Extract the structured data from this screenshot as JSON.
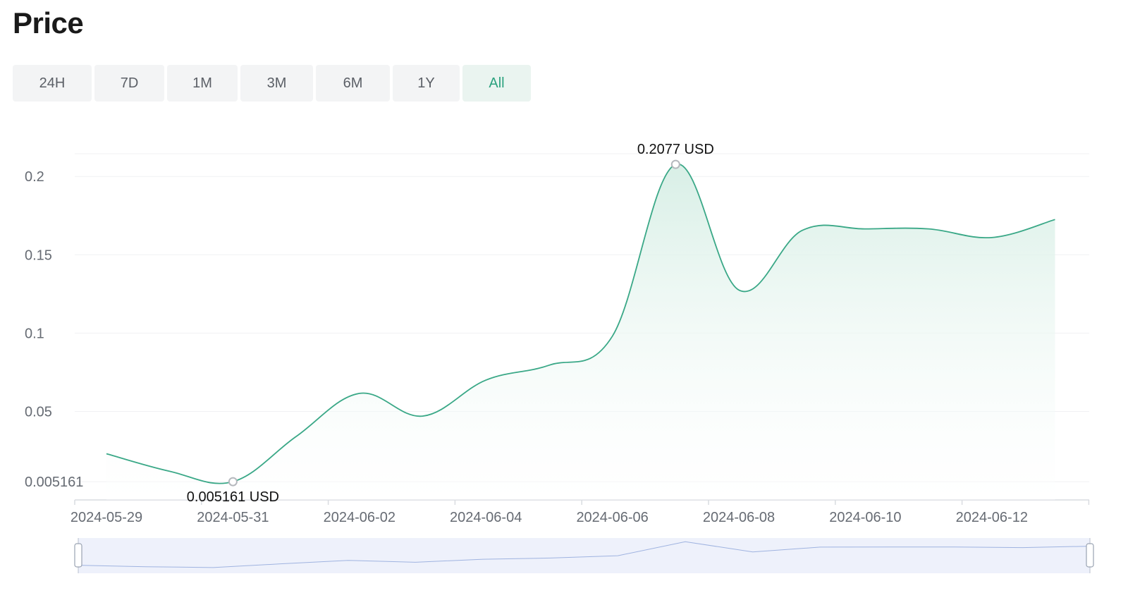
{
  "page": {
    "title": "Price"
  },
  "range_tabs": [
    {
      "label": "24H",
      "active": false
    },
    {
      "label": "7D",
      "active": false
    },
    {
      "label": "1M",
      "active": false
    },
    {
      "label": "3M",
      "active": false
    },
    {
      "label": "6M",
      "active": false
    },
    {
      "label": "1Y",
      "active": false
    },
    {
      "label": "All",
      "active": true
    }
  ],
  "colors": {
    "line": "#3aa887",
    "area_top": "#d8efe6",
    "tab_active_text": "#2ca27f",
    "zoom_bg": "#eef1fb",
    "zoom_line": "#9fb3e0"
  },
  "chart_data": {
    "type": "area",
    "title": "",
    "xlabel": "",
    "ylabel": "",
    "x": [
      "2024-05-29",
      "2024-05-30",
      "2024-05-31",
      "2024-06-01",
      "2024-06-02",
      "2024-06-03",
      "2024-06-04",
      "2024-06-05",
      "2024-06-06",
      "2024-06-07",
      "2024-06-08",
      "2024-06-09",
      "2024-06-10",
      "2024-06-11",
      "2024-06-12",
      "2024-06-13"
    ],
    "series": [
      {
        "values": [
          0.023,
          0.0118,
          0.005161,
          0.034,
          0.0615,
          0.047,
          0.07,
          0.0795,
          0.098,
          0.2077,
          0.1275,
          0.1655,
          0.1665,
          0.1665,
          0.161,
          0.1725
        ]
      }
    ],
    "x_tick_labels": [
      "2024-05-29",
      "2024-05-31",
      "2024-06-02",
      "2024-06-04",
      "2024-06-06",
      "2024-06-08",
      "2024-06-10",
      "2024-06-12"
    ],
    "y_ticks": [
      0.005161,
      0.05,
      0.1,
      0.15,
      0.2
    ],
    "y_tick_labels": [
      "0.005161",
      "0.05",
      "0.1",
      "0.15",
      "0.2"
    ],
    "ylim": [
      -0.0065,
      0.2145
    ],
    "grid": true,
    "annotations": [
      {
        "type": "max",
        "x": "2024-06-07",
        "value": 0.2077,
        "label": "0.2077",
        "unit": "USD"
      },
      {
        "type": "min",
        "x": "2024-05-31",
        "value": 0.005161,
        "label": "0.005161",
        "unit": "USD"
      }
    ],
    "zoom_slider": {
      "start": 0,
      "end": 1
    }
  }
}
